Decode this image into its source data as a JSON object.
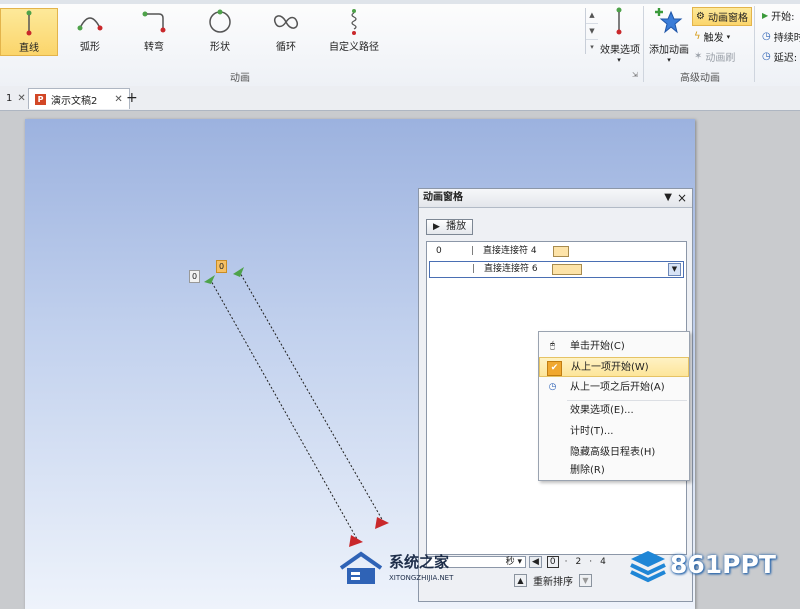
{
  "ribbon": {
    "gallery_items": [
      {
        "label": "直线",
        "icon": "line-path-icon",
        "selected": true
      },
      {
        "label": "弧形",
        "icon": "arc-path-icon",
        "selected": false
      },
      {
        "label": "转弯",
        "icon": "turn-path-icon",
        "selected": false
      },
      {
        "label": "形状",
        "icon": "shape-path-icon",
        "selected": false
      },
      {
        "label": "循环",
        "icon": "loop-path-icon",
        "selected": false
      },
      {
        "label": "自定义路径",
        "icon": "custom-path-icon",
        "selected": false
      }
    ],
    "effect_options_label": "效果选项",
    "animation_group_label": "动画",
    "add_animation_label": "添加动画",
    "animation_pane_label": "动画窗格",
    "trigger_label": "触发",
    "animation_painter_label": "动画刷",
    "advanced_group_label": "高级动画",
    "start_label": "开始:",
    "duration_label": "持续时",
    "delay_label": "延迟:"
  },
  "tabs": {
    "prev_tab_label": "1",
    "doc_tab_label": "演示文稿2",
    "new_tab_symbol": "+"
  },
  "slide": {
    "tag_left": "0",
    "tag_right": "0"
  },
  "pane": {
    "title": "动画窗格",
    "dropdown_glyph": "▼",
    "close_glyph": "×",
    "play_label": "播放",
    "rows": [
      {
        "num": "0",
        "name": "直接连接符 4"
      },
      {
        "num": "",
        "name": "直接连接符 6"
      }
    ],
    "menu": [
      "单击开始(C)",
      "从上一项开始(W)",
      "从上一项之后开始(A)",
      "效果选项(E)...",
      "计时(T)...",
      "隐藏高级日程表(H)",
      "删除(R)"
    ],
    "timeline_unit": "秒",
    "timeline_ticks": [
      "0",
      "2",
      "4"
    ],
    "reorder_label": "重新排序"
  },
  "watermarks": {
    "left_title": "系统之家",
    "left_url": "XITONGZHIJIA.NET",
    "right_text": "861PPT"
  },
  "colors": {
    "accent_green": "#4ea24a",
    "highlight": "#fbd56b",
    "path_red": "#c9282b",
    "swatch": "#fde3a8"
  }
}
